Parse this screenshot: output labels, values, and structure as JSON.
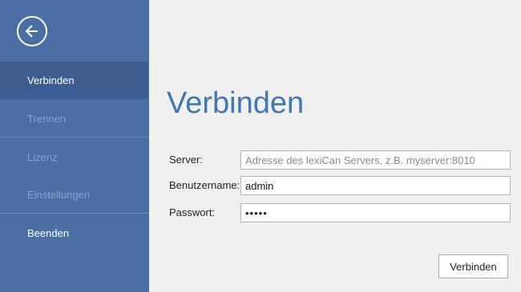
{
  "sidebar": {
    "back_icon": "arrow-left-circle-icon",
    "items": [
      {
        "label": "Verbinden",
        "state": "active"
      },
      {
        "label": "Trennen",
        "state": "disabled"
      },
      {
        "label": "Lizenz",
        "state": "disabled"
      },
      {
        "label": "Einstellungen",
        "state": "disabled"
      },
      {
        "label": "Beenden",
        "state": "enabled"
      }
    ]
  },
  "main": {
    "title": "Verbinden",
    "form": {
      "server_label": "Server:",
      "server_value": "",
      "server_placeholder": "Adresse des lexiCan Servers, z.B. myserver:8010",
      "username_label": "Benutzername:",
      "username_value": "admin",
      "password_label": "Passwort:",
      "password_value": "admin"
    },
    "connect_button": "Verbinden"
  },
  "colors": {
    "sidebar_bg": "#4a6fa5",
    "sidebar_active_bg": "#3c5d8f",
    "sidebar_disabled_text": "#8aa3c8",
    "title_color": "#3f78b4",
    "content_bg": "#f0f0f0"
  }
}
